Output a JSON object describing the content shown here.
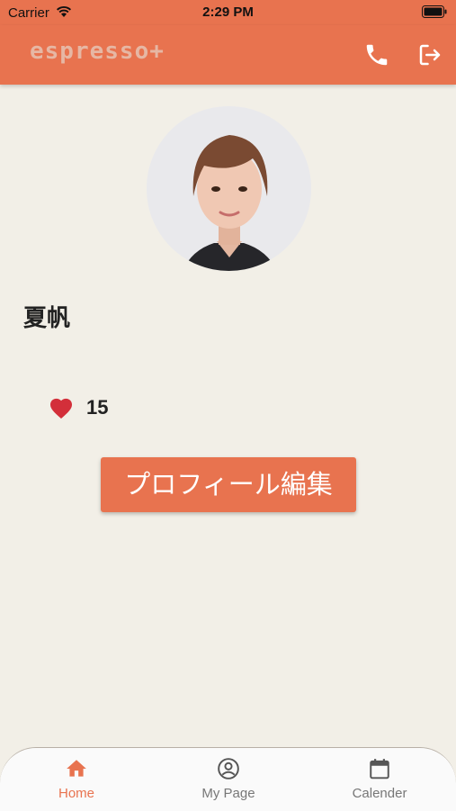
{
  "status_bar": {
    "carrier": "Carrier",
    "time": "2:29 PM"
  },
  "app_bar": {
    "logo": "espresso+",
    "phone_icon": "phone-icon",
    "logout_icon": "logout-icon"
  },
  "profile": {
    "name": "夏帆",
    "likes": "15",
    "edit_label": "プロフィール編集"
  },
  "nav": {
    "items": [
      {
        "label": "Home",
        "icon": "home-icon",
        "active": true
      },
      {
        "label": "My Page",
        "icon": "account-circle-icon",
        "active": false
      },
      {
        "label": "Calender",
        "icon": "calendar-icon",
        "active": false
      }
    ]
  },
  "colors": {
    "accent": "#e8734f",
    "background": "#f2efe7",
    "heart": "#d32f3a"
  }
}
